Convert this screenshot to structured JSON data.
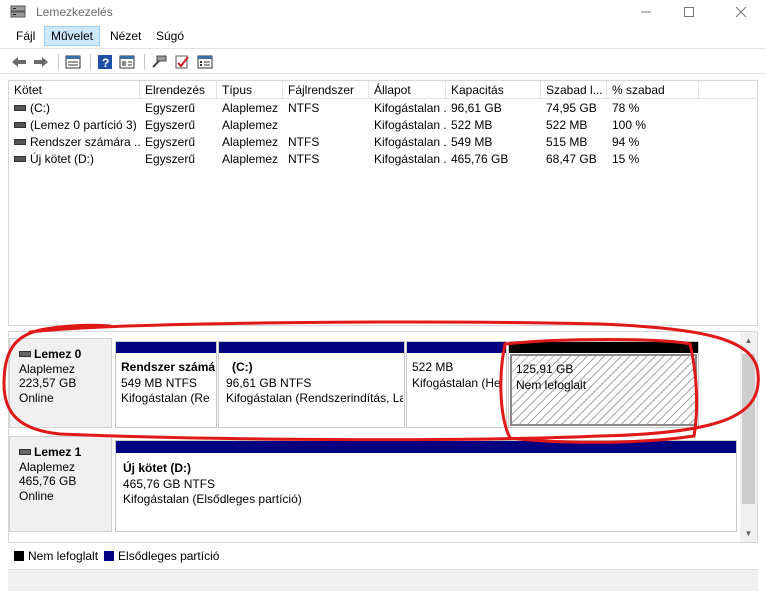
{
  "window": {
    "title": "Lemezkezelés"
  },
  "menu": {
    "items": [
      "Fájl",
      "Művelet",
      "Nézet",
      "Súgó"
    ],
    "active_index": 1
  },
  "toolbar": {
    "icons": [
      "back-arrow-icon",
      "forward-arrow-icon",
      "disk-list-icon",
      "help-icon",
      "properties-icon",
      "connect-icon",
      "check-icon",
      "settings-icon"
    ]
  },
  "volumes": {
    "columns": [
      "Kötet",
      "Elrendezés",
      "Típus",
      "Fájlrendszer",
      "Állapot",
      "Kapacitás",
      "Szabad l...",
      "% szabad"
    ],
    "rows": [
      [
        "(C:)",
        "Egyszerű",
        "Alaplemez",
        "NTFS",
        "Kifogástalan ...",
        "96,61 GB",
        "74,95 GB",
        "78 %"
      ],
      [
        "(Lemez 0 partíció 3)",
        "Egyszerű",
        "Alaplemez",
        "",
        "Kifogástalan ...",
        "522 MB",
        "522 MB",
        "100 %"
      ],
      [
        "Rendszer számára ...",
        "Egyszerű",
        "Alaplemez",
        "NTFS",
        "Kifogástalan ...",
        "549 MB",
        "515 MB",
        "94 %"
      ],
      [
        "Új kötet (D:)",
        "Egyszerű",
        "Alaplemez",
        "NTFS",
        "Kifogástalan ...",
        "465,76 GB",
        "68,47 GB",
        "15 %"
      ]
    ]
  },
  "disks": [
    {
      "name": "Lemez 0",
      "type": "Alaplemez",
      "size": "223,57 GB",
      "status": "Online",
      "partitions": [
        {
          "name": "Rendszer számá",
          "size": "549 MB NTFS",
          "status": "Kifogástalan (Re"
        },
        {
          "name": "(C:)",
          "size": "96,61 GB NTFS",
          "status": "Kifogástalan (Rendszerindítás, La"
        },
        {
          "name": "",
          "size": "522 MB",
          "status": "Kifogástalan (He"
        },
        {
          "name": "",
          "size": "125,91 GB",
          "status": "Nem lefoglalt"
        }
      ]
    },
    {
      "name": "Lemez 1",
      "type": "Alaplemez",
      "size": "465,76 GB",
      "status": "Online",
      "partitions": [
        {
          "name": "Új kötet  (D:)",
          "size": "465,76 GB NTFS",
          "status": "Kifogástalan (Elsődleges partíció)"
        }
      ]
    }
  ],
  "legend": [
    {
      "label": "Nem lefoglalt",
      "color": "#000000"
    },
    {
      "label": "Elsődleges partíció",
      "color": "#000080"
    }
  ],
  "colors": {
    "primary_partition": "#000080",
    "unallocated": "#000000",
    "annotation": "#e01818",
    "menu_active": "#cce8ff"
  }
}
